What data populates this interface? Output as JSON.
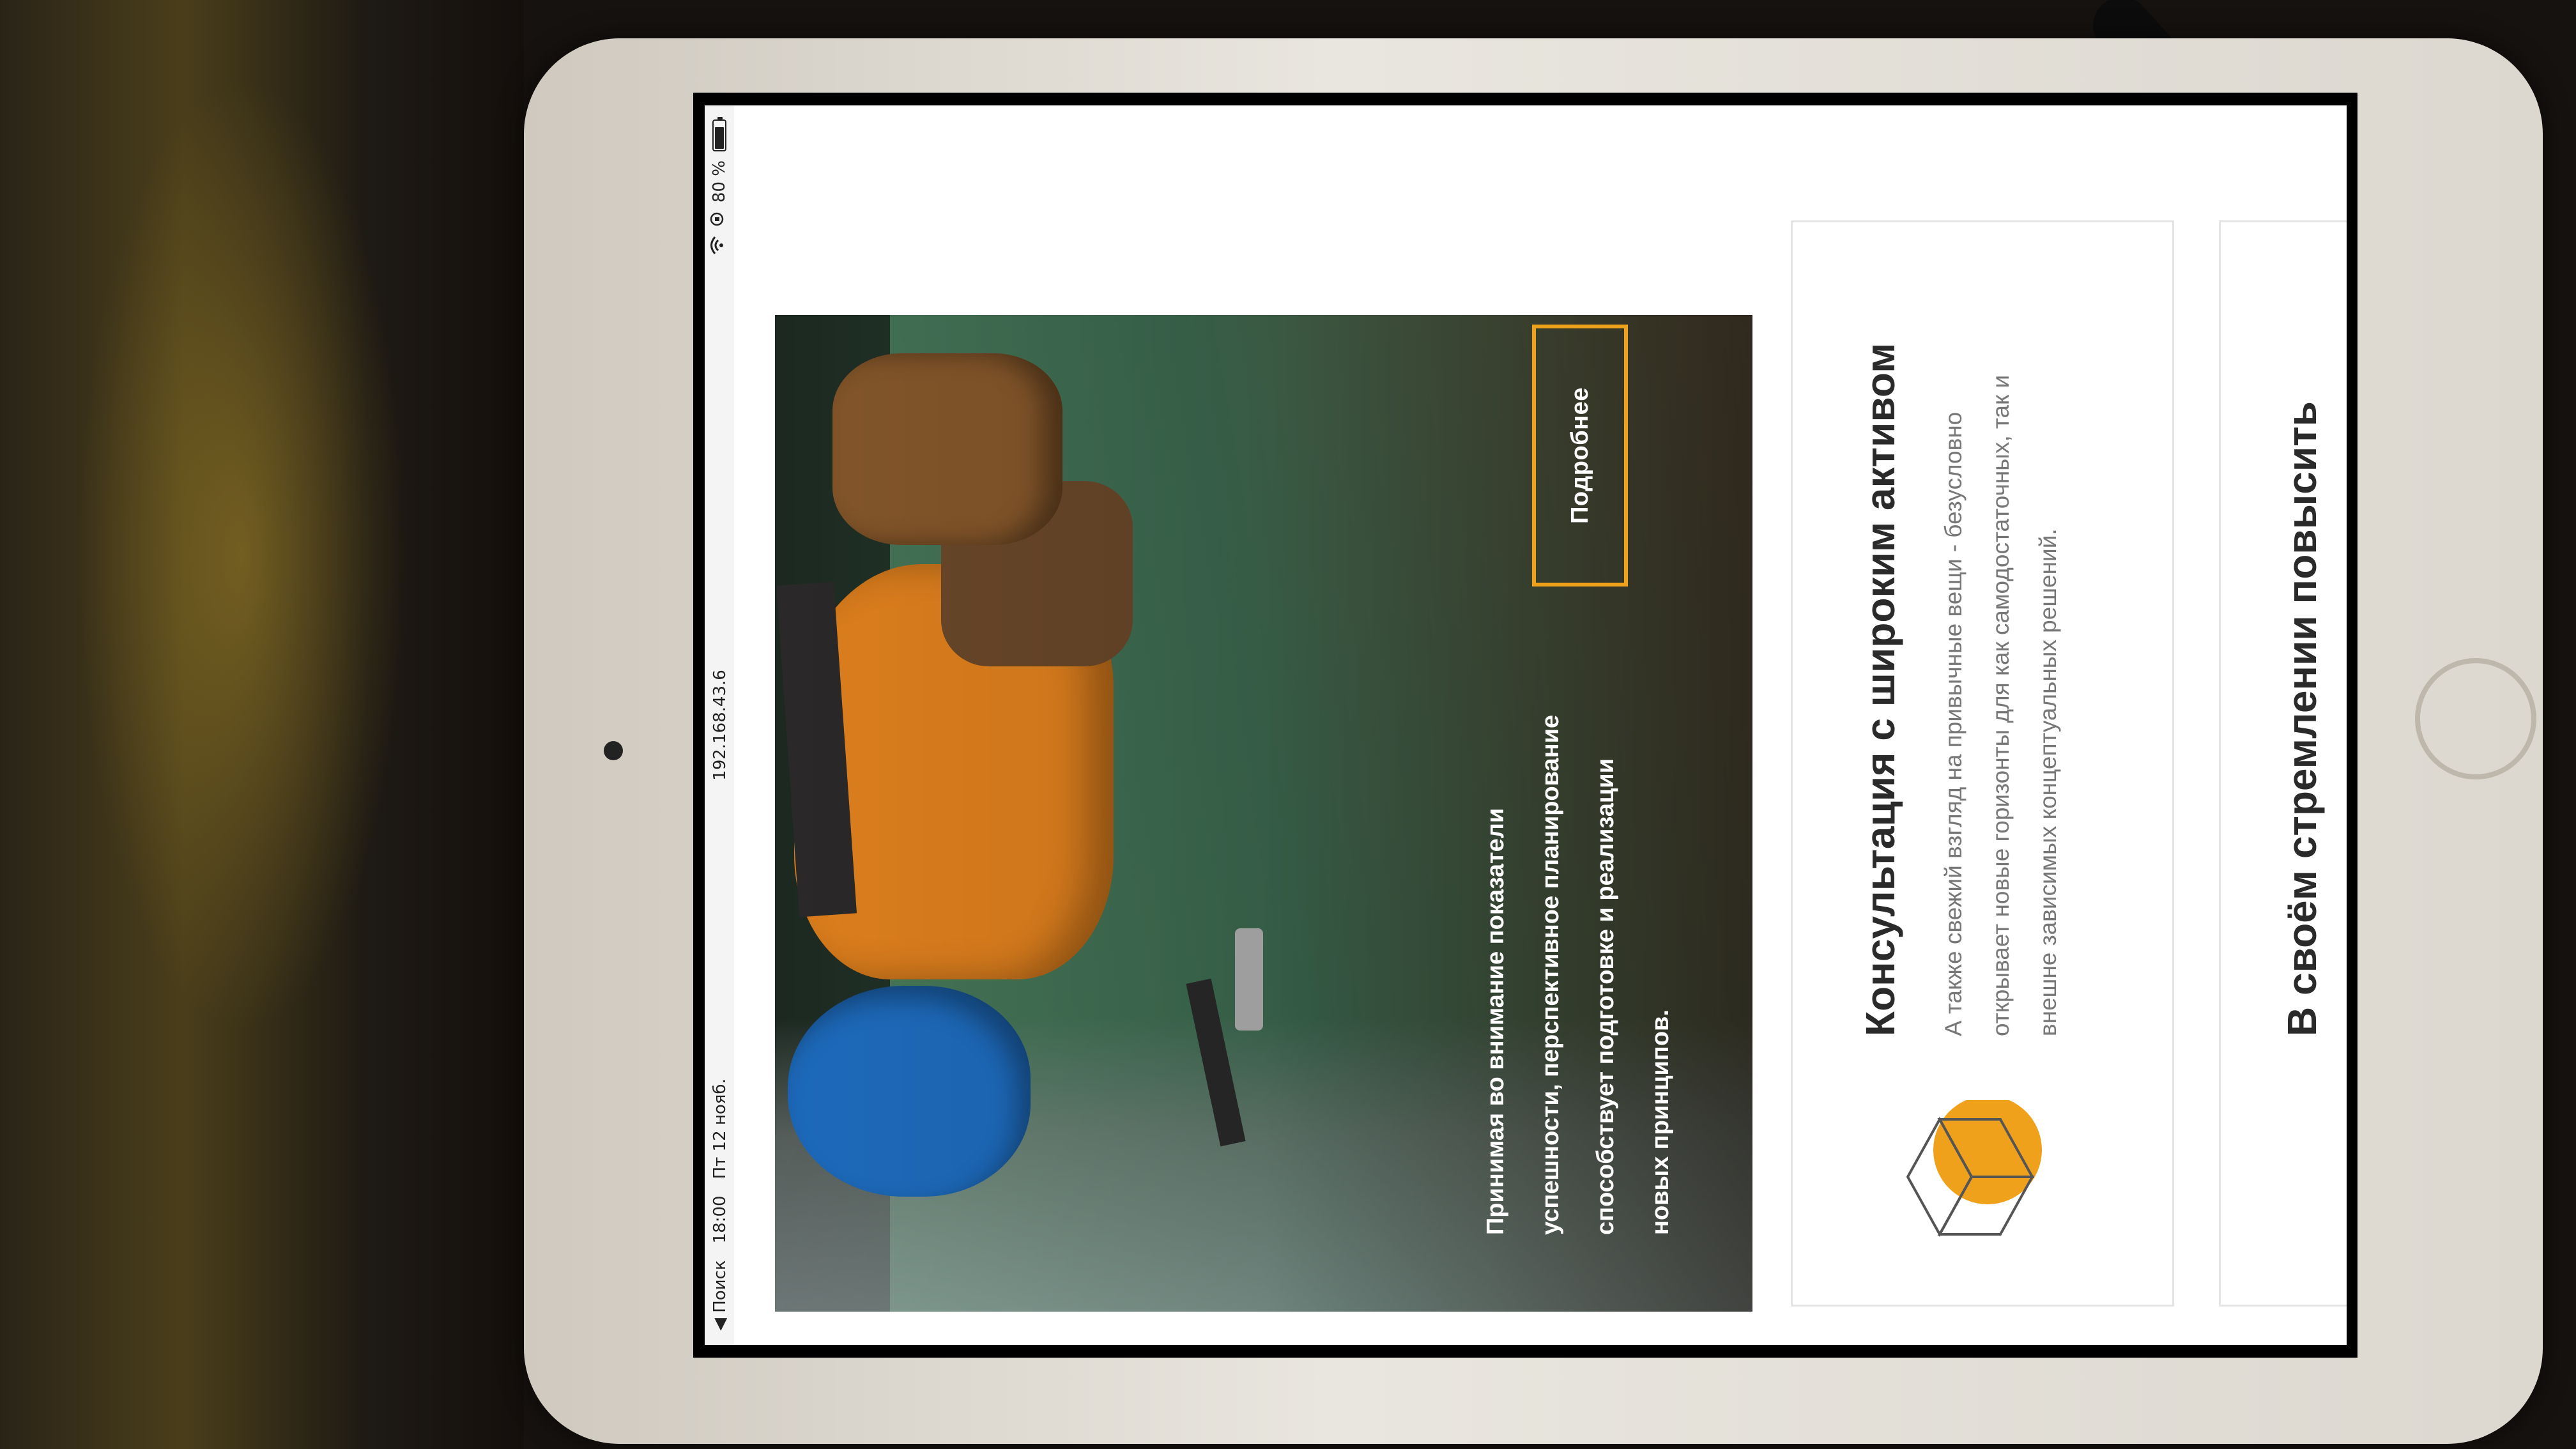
{
  "status_bar": {
    "back_label": "◀ Поиск",
    "time": "18:00",
    "date": "Пт 12 нояб.",
    "url": "192.168.43.6",
    "battery_text": "80 %",
    "battery_level": 0.8
  },
  "hero": {
    "text": "Принимая во внимание показатели успешности, перспективное планирование способствует подготовке и реализации новых принципов.",
    "button_label": "Подробнее"
  },
  "cards": [
    {
      "title": "Консультация с широким активом",
      "body": "А также свежий взгляд на привычные вещи - безусловно открывает новые горизонты для как самодостаточных, так и внешне зависимых концептуальных решений."
    },
    {
      "title": "В своём стремлении повысить"
    }
  ],
  "colors": {
    "accent": "#f0a11b",
    "title": "#2a2a2a",
    "body": "#777777",
    "card_border": "#e4e4e4"
  },
  "icons": {
    "cube": "cube-icon",
    "wifi": "wifi-icon",
    "battery": "battery-icon",
    "back": "back-arrow-icon"
  }
}
